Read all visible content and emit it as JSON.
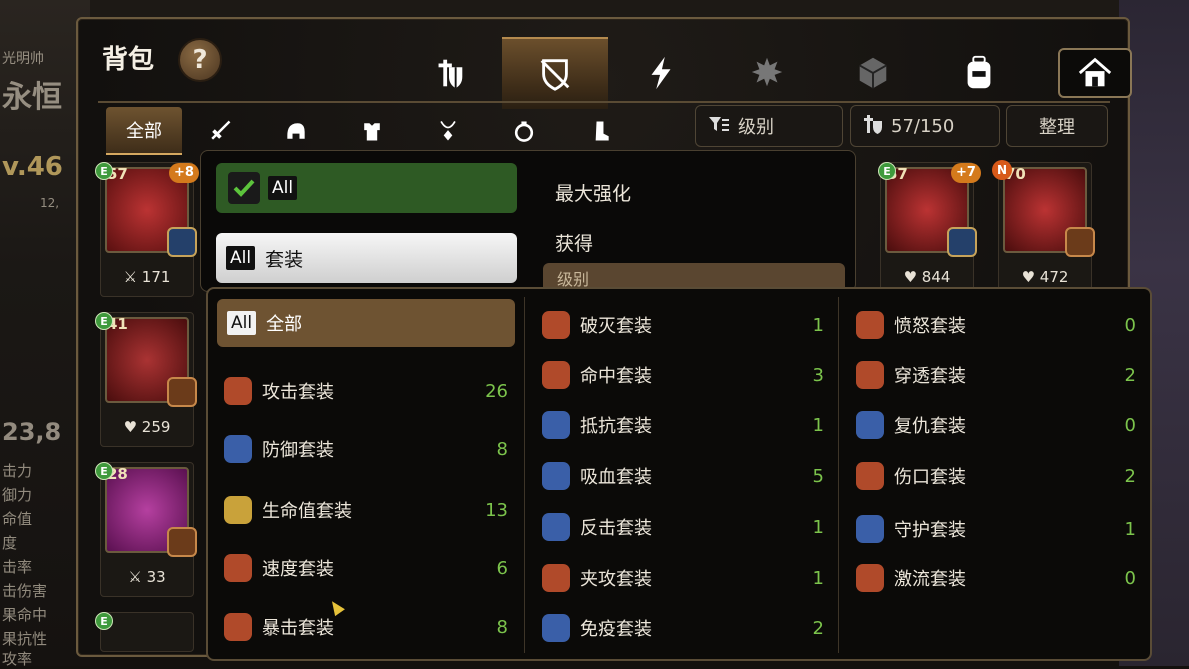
{
  "background": {
    "left_texts": [
      "光明帅",
      "永恒",
      "v.46",
      "12,",
      "23,8",
      "击力",
      "御力",
      "命值",
      "度",
      "击率",
      "击伤害",
      "果命中",
      "果抗性",
      "攻率"
    ],
    "bottom_pct": "3.0%"
  },
  "header": {
    "title": "背包",
    "help_label": "?"
  },
  "top_tabs": [
    {
      "icon": "knight-armor-icon",
      "active": false
    },
    {
      "icon": "crossed-shield-icon",
      "active": true
    },
    {
      "icon": "lightning-icon",
      "active": false
    },
    {
      "icon": "splatter-icon",
      "active": false
    },
    {
      "icon": "cube-icon",
      "active": false
    },
    {
      "icon": "backpack-icon",
      "active": false
    },
    {
      "icon": "house-icon",
      "active": false
    }
  ],
  "filter_tabs": [
    {
      "label": "全部",
      "active": true
    },
    {
      "icon": "sword-icon"
    },
    {
      "icon": "helmet-icon"
    },
    {
      "icon": "armor-icon"
    },
    {
      "icon": "necklace-icon"
    },
    {
      "icon": "ring-icon"
    },
    {
      "icon": "boots-icon"
    }
  ],
  "controls": {
    "sort_label": "级别",
    "capacity": "57/150",
    "arrange_label": "整理"
  },
  "items_left": [
    {
      "level": "57",
      "plus": "+8",
      "stat_icon": "sword",
      "stat": "171",
      "color": "#7a1c1c"
    },
    {
      "level": "41",
      "stat_icon": "heart",
      "stat": "259",
      "color": "#7a1c1c"
    },
    {
      "level": "28",
      "stat_icon": "sword",
      "stat": "33",
      "color": "#8a1f78"
    }
  ],
  "items_right": [
    {
      "level": "57",
      "plus": "+7",
      "stat": "844",
      "color": "#7a1c1c"
    },
    {
      "level": "70",
      "new": "N",
      "stat": "472",
      "color": "#7a1c1c"
    }
  ],
  "sort_menu": {
    "all_label": "All",
    "set_label": "套装",
    "options": [
      "最大强化",
      "获得",
      "级别"
    ]
  },
  "set_filter": {
    "all_label": "全部",
    "col1": [
      {
        "name": "攻击套装",
        "count": "26",
        "color": "#b04a2a"
      },
      {
        "name": "防御套装",
        "count": "8",
        "color": "#3a5fa8"
      },
      {
        "name": "生命值套装",
        "count": "13",
        "color": "#c9a23a"
      },
      {
        "name": "速度套装",
        "count": "6",
        "color": "#b04a2a"
      },
      {
        "name": "暴击套装",
        "count": "8",
        "color": "#b04a2a"
      }
    ],
    "col2": [
      {
        "name": "破灭套装",
        "count": "1",
        "color": "#b04a2a"
      },
      {
        "name": "命中套装",
        "count": "3",
        "color": "#b04a2a"
      },
      {
        "name": "抵抗套装",
        "count": "1",
        "color": "#3a5fa8"
      },
      {
        "name": "吸血套装",
        "count": "5",
        "color": "#3a5fa8"
      },
      {
        "name": "反击套装",
        "count": "1",
        "color": "#3a5fa8"
      },
      {
        "name": "夹攻套装",
        "count": "1",
        "color": "#b04a2a"
      },
      {
        "name": "免疫套装",
        "count": "2",
        "color": "#3a5fa8"
      }
    ],
    "col3": [
      {
        "name": "愤怒套装",
        "count": "0",
        "color": "#b04a2a"
      },
      {
        "name": "穿透套装",
        "count": "2",
        "color": "#b04a2a"
      },
      {
        "name": "复仇套装",
        "count": "0",
        "color": "#3a5fa8"
      },
      {
        "name": "伤口套装",
        "count": "2",
        "color": "#b04a2a"
      },
      {
        "name": "守护套装",
        "count": "1",
        "color": "#3a5fa8"
      },
      {
        "name": "激流套装",
        "count": "0",
        "color": "#b04a2a"
      }
    ]
  }
}
